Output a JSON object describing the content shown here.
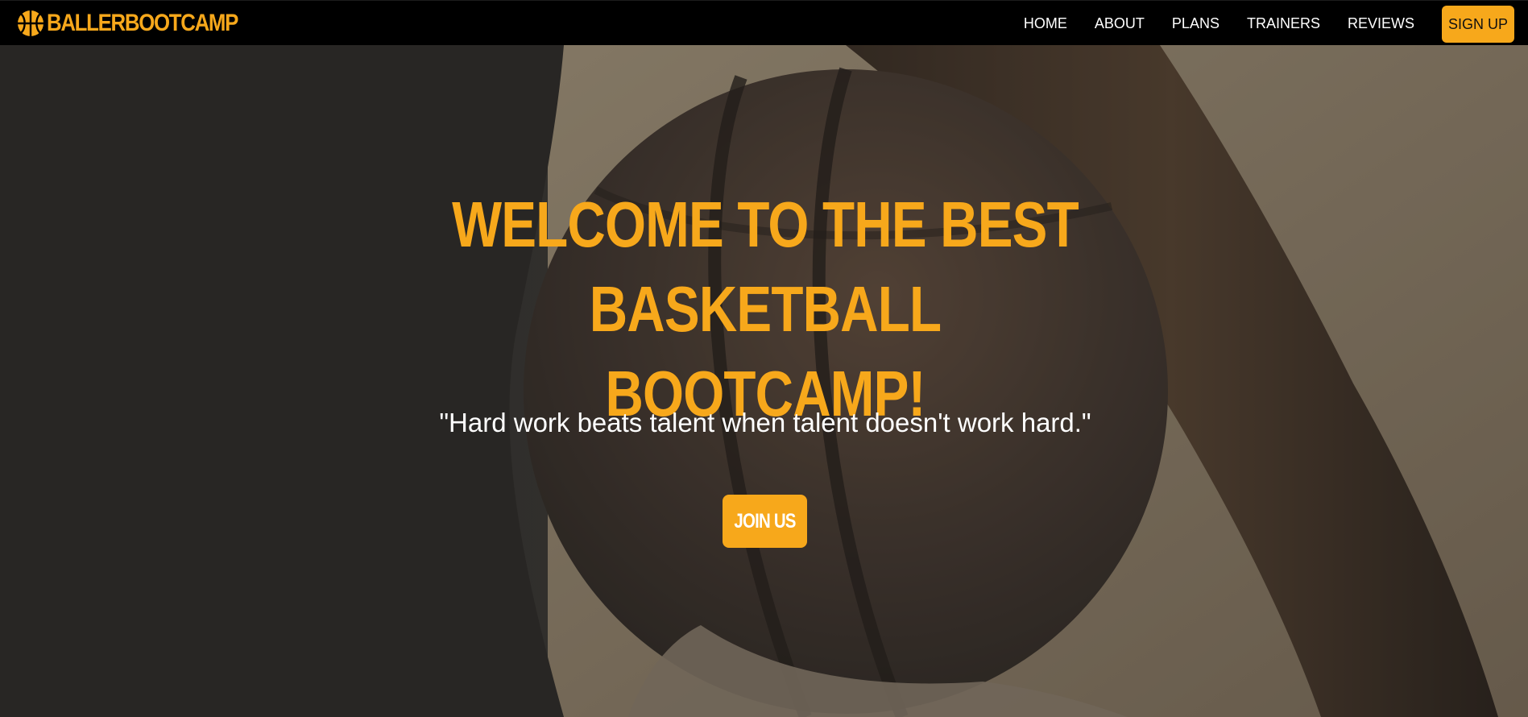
{
  "navbar": {
    "brand": {
      "text": "BALLERBOOTCAMP",
      "icon": "basketball-icon"
    },
    "links": [
      {
        "label": "HOME"
      },
      {
        "label": "ABOUT"
      },
      {
        "label": "PLANS"
      },
      {
        "label": "TRAINERS"
      },
      {
        "label": "REVIEWS"
      }
    ],
    "signup_label": "SIGN UP"
  },
  "hero": {
    "title_line1": "WELCOME TO THE BEST",
    "title_line2": "BASKETBALL BOOTCAMP!",
    "quote": "\"Hard work beats talent when talent doesn't work hard.\"",
    "cta_label": "JOIN US",
    "background": "basketball-photo"
  },
  "colors": {
    "accent": "#f7a81b",
    "navbar_bg": "#000000",
    "text_light": "#ffffff"
  }
}
